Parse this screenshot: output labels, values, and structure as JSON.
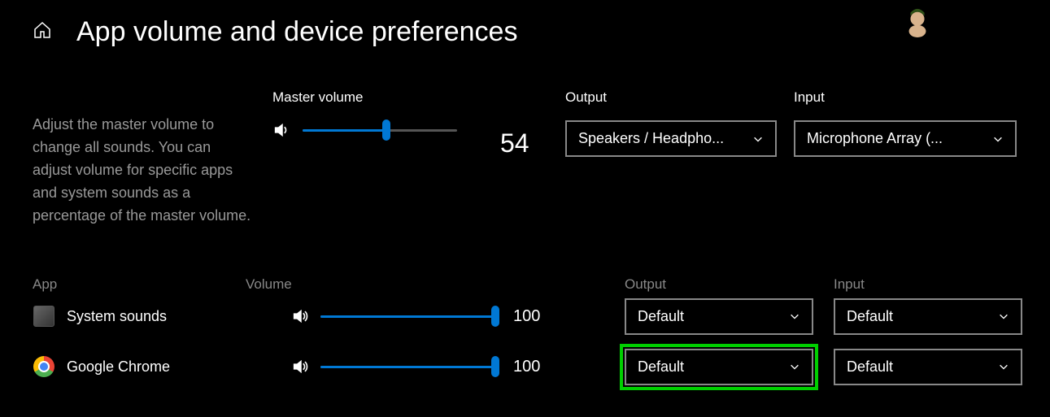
{
  "title": "App volume and device preferences",
  "description": "Adjust the master volume to change all sounds. You can adjust volume for specific apps and system sounds as a percentage of the master volume.",
  "master": {
    "label": "Master volume",
    "value": 54,
    "percent": 54
  },
  "outputMaster": {
    "label": "Output",
    "selected": "Speakers / Headpho..."
  },
  "inputMaster": {
    "label": "Input",
    "selected": "Microphone Array (..."
  },
  "columns": {
    "app": "App",
    "volume": "Volume",
    "output": "Output",
    "input": "Input"
  },
  "apps": [
    {
      "name": "System sounds",
      "icon": "system-sounds-icon",
      "volume": 100,
      "output": "Default",
      "input": "Default",
      "highlightOutput": false
    },
    {
      "name": "Google Chrome",
      "icon": "chrome-icon",
      "volume": 100,
      "output": "Default",
      "input": "Default",
      "highlightOutput": true
    }
  ]
}
